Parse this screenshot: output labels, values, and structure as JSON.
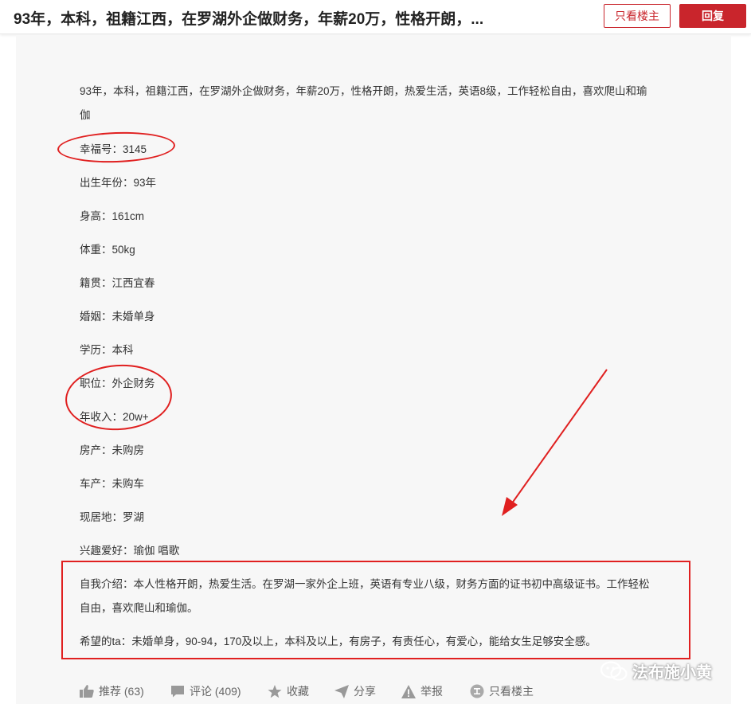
{
  "header": {
    "title": "93年，本科，祖籍江西，在罗湖外企做财务，年薪20万，性格开朗，...",
    "only_author_label": "只看楼主",
    "reply_label": "回复"
  },
  "post": {
    "intro_line1": "93年，本科，祖籍江西，在罗湖外企做财务，年薪20万，性格开朗，热爱生活，英语8级，工作轻松自由，喜欢爬山和瑜",
    "intro_line2": "伽",
    "fields": [
      "幸福号：3145",
      "出生年份：93年",
      "身高：161cm",
      "体重：50kg",
      "籍贯：江西宜春",
      "婚姻：未婚单身",
      "学历：本科",
      "职位：外企财务",
      "年收入：20w+",
      "房产：未购房",
      "车产：未购车",
      "现居地：罗湖",
      "兴趣爱好：瑜伽 唱歌"
    ],
    "self_intro_line1": "自我介绍：本人性格开朗，热爱生活。在罗湖一家外企上班，英语有专业八级，财务方面的证书初中高级证书。工作轻松",
    "self_intro_line2": "自由，喜欢爬山和瑜伽。",
    "wish": "希望的ta：未婚单身，90-94，170及以上，本科及以上，有房子，有责任心，有爱心，能给女生足够安全感。"
  },
  "actions": {
    "recommend": "推荐 (63)",
    "comment": "评论 (409)",
    "favorite": "收藏",
    "share": "分享",
    "report": "举报",
    "only_author": "只看楼主"
  },
  "watermark": "法布施小黄",
  "colors": {
    "accent": "#c9252c",
    "annotation": "#e02020"
  }
}
